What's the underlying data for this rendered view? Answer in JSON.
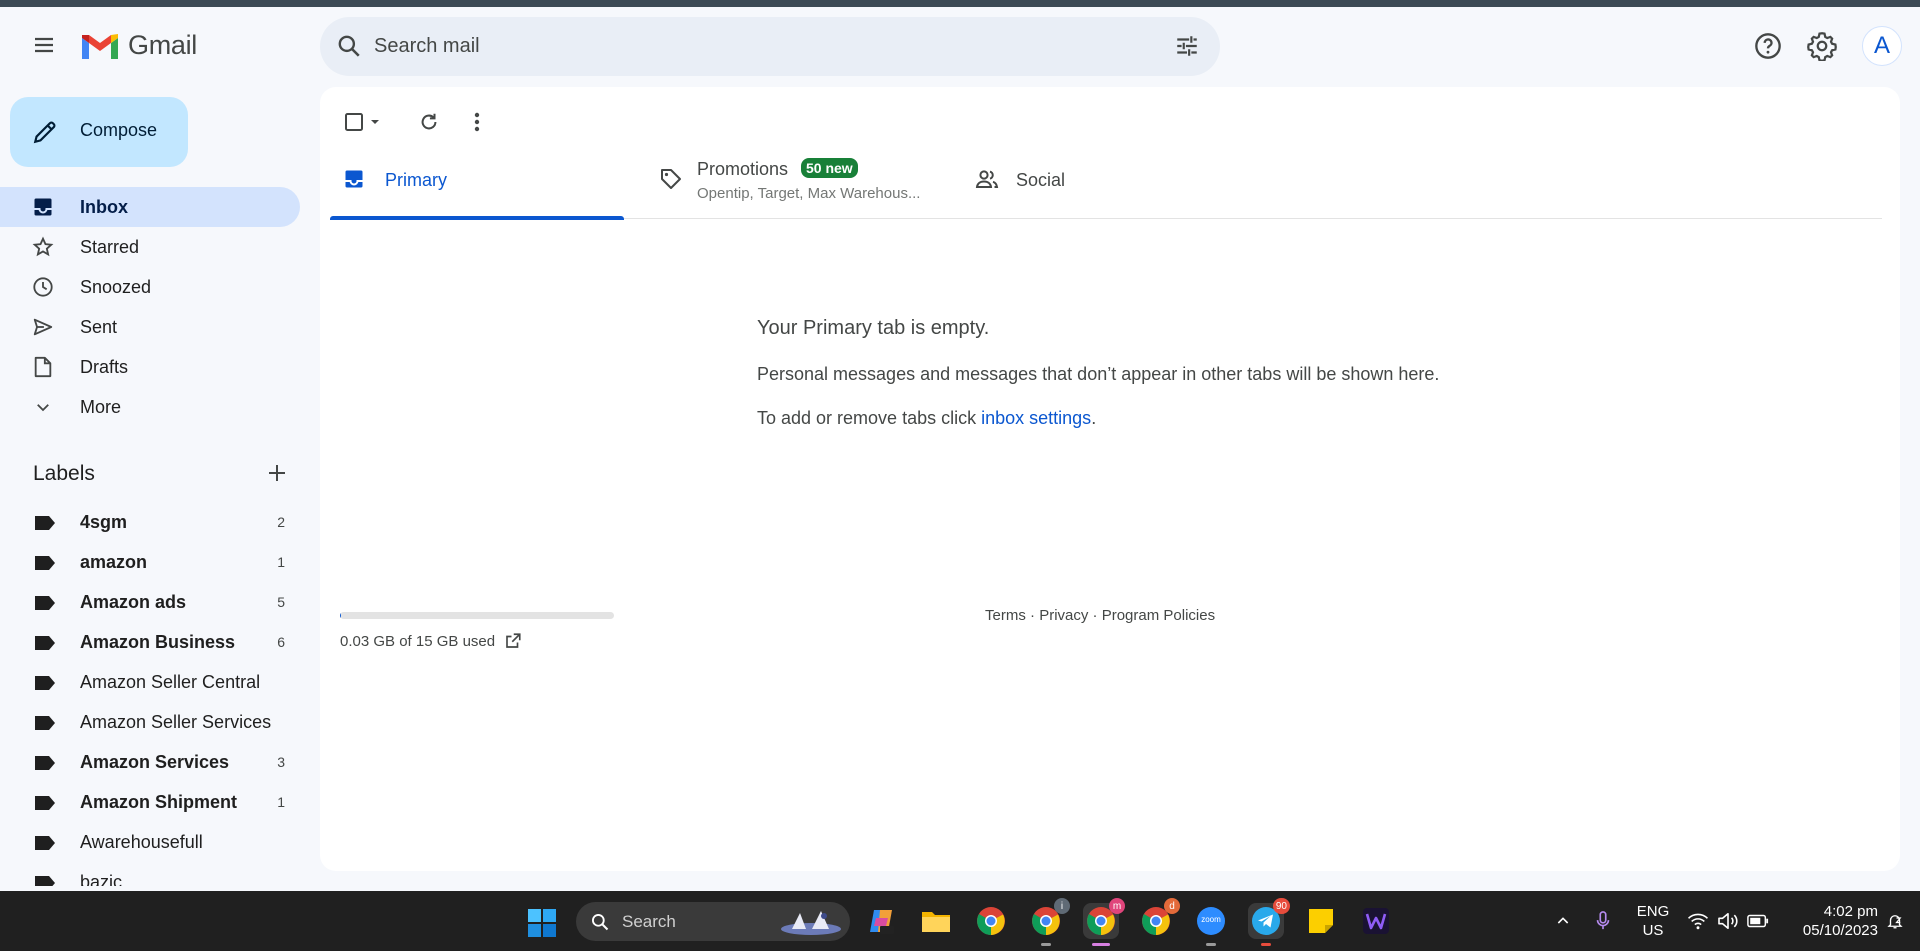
{
  "header": {
    "app_name": "Gmail",
    "search_placeholder": "Search mail",
    "avatar_letter": "A",
    "colors": {
      "accent": "#0b57d0",
      "compose_bg": "#c2e7ff",
      "active_nav": "#d3e3fd",
      "badge": "#188038"
    }
  },
  "sidebar": {
    "compose_label": "Compose",
    "nav": [
      {
        "label": "Inbox",
        "icon": "inbox-icon"
      },
      {
        "label": "Starred",
        "icon": "star-icon"
      },
      {
        "label": "Snoozed",
        "icon": "clock-icon"
      },
      {
        "label": "Sent",
        "icon": "send-icon"
      },
      {
        "label": "Drafts",
        "icon": "draft-icon"
      },
      {
        "label": "More",
        "icon": "chevron-down-icon"
      }
    ],
    "labels_heading": "Labels",
    "labels": [
      {
        "name": "4sgm",
        "count": "2"
      },
      {
        "name": "amazon",
        "count": "1"
      },
      {
        "name": "Amazon ads",
        "count": "5"
      },
      {
        "name": "Amazon Business",
        "count": "6"
      },
      {
        "name": "Amazon Seller Central",
        "count": ""
      },
      {
        "name": "Amazon Seller Services",
        "count": ""
      },
      {
        "name": "Amazon Services",
        "count": "3"
      },
      {
        "name": "Amazon Shipment",
        "count": "1"
      },
      {
        "name": "Awarehousefull",
        "count": ""
      },
      {
        "name": "bazic",
        "count": ""
      }
    ]
  },
  "tabs": {
    "primary": "Primary",
    "promotions": "Promotions",
    "promotions_badge": "50 new",
    "promotions_senders": "Opentip, Target, Max Warehous...",
    "social": "Social"
  },
  "empty": {
    "title": "Your Primary tab is empty.",
    "message": "Personal messages and messages that don’t appear in other tabs will be shown here.",
    "hint_prefix": "To add or remove tabs click ",
    "hint_link": "inbox settings",
    "hint_suffix": "."
  },
  "storage": {
    "text": "0.03 GB of 15 GB used",
    "fraction_used": 0.002
  },
  "footer": {
    "terms": "Terms",
    "privacy": "Privacy",
    "policies": "Program Policies",
    "sep": " · "
  },
  "taskbar": {
    "search_label": "Search",
    "chrome_badge_1": "i",
    "chrome_badge_2": "m",
    "chrome_badge_3": "d",
    "zoom_label": "zoom",
    "telegram_badge": "90",
    "lang_line1": "ENG",
    "lang_line2": "US",
    "time": "4:02 pm",
    "date": "05/10/2023"
  }
}
